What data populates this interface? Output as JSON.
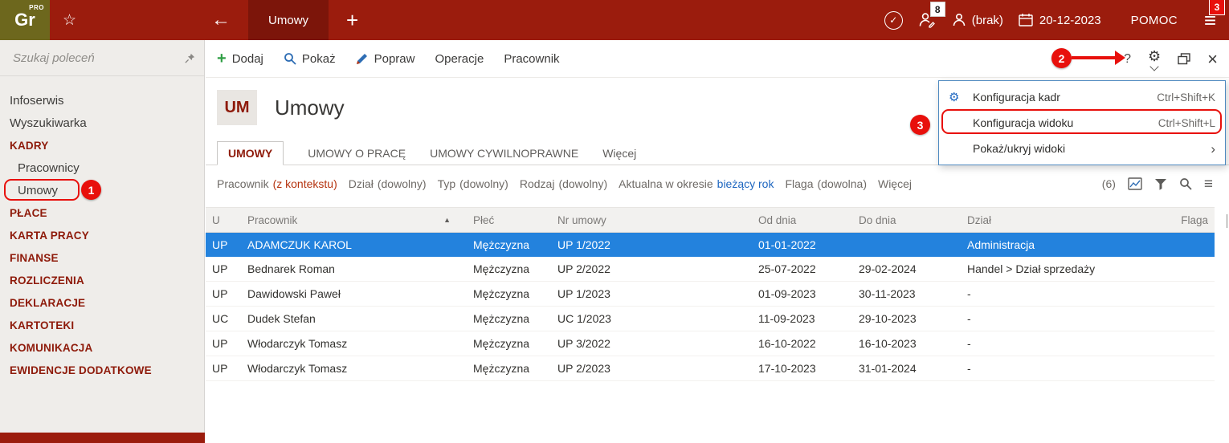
{
  "colors": {
    "brand_red": "#9b1c0d",
    "logo_olive": "#6d671d",
    "annotation_red": "#e8100c",
    "selection_blue": "#2382dd",
    "sidebar_header_red": "#8e1a0a",
    "filter_value_red": "#b5330f",
    "filter_value_blue": "#1f67c0"
  },
  "topbar": {
    "logo_text": "Gr",
    "logo_sup": "PRO",
    "active_tab": "Umowy",
    "sessions_badge": "8",
    "user_label": "(brak)",
    "date": "20-12-2023",
    "help_label": "POMOC",
    "menu_badge": "3"
  },
  "sidebar": {
    "search_placeholder": "Szukaj poleceń",
    "items": [
      {
        "label": "Infoserwis"
      },
      {
        "label": "Wyszukiwarka"
      },
      {
        "label": "KADRY"
      },
      {
        "label": "Pracownicy"
      },
      {
        "label": "Umowy"
      },
      {
        "label": "PŁACE"
      },
      {
        "label": "KARTA PRACY"
      },
      {
        "label": "FINANSE"
      },
      {
        "label": "ROZLICZENIA"
      },
      {
        "label": "DEKLARACJE"
      },
      {
        "label": "KARTOTEKI"
      },
      {
        "label": "KOMUNIKACJA"
      },
      {
        "label": "EWIDENCJE DODATKOWE"
      }
    ]
  },
  "toolbar": {
    "add_label": "Dodaj",
    "show_label": "Pokaż",
    "edit_label": "Popraw",
    "operations_label": "Operacje",
    "employee_label": "Pracownik"
  },
  "context_menu": {
    "items": [
      {
        "label": "Konfiguracja kadr",
        "shortcut": "Ctrl+Shift+K"
      },
      {
        "label": "Konfiguracja widoku",
        "shortcut": "Ctrl+Shift+L"
      },
      {
        "label": "Pokaż/ukryj widoki"
      }
    ]
  },
  "page": {
    "module_badge": "UM",
    "title": "Umowy",
    "tabs": [
      {
        "label": "UMOWY"
      },
      {
        "label": "UMOWY O PRACĘ"
      },
      {
        "label": "UMOWY CYWILNOPRAWNE"
      },
      {
        "label": "Więcej"
      }
    ],
    "filters": [
      {
        "label": "Pracownik",
        "value": "(z kontekstu)"
      },
      {
        "label": "Dział",
        "value": "(dowolny)"
      },
      {
        "label": "Typ",
        "value": "(dowolny)"
      },
      {
        "label": "Rodzaj",
        "value": "(dowolny)"
      },
      {
        "label": "Aktualna w okresie",
        "value": "bieżący rok"
      },
      {
        "label": "Flaga",
        "value": "(dowolna)"
      },
      {
        "label": "Więcej",
        "value": ""
      }
    ],
    "record_count": "(6)"
  },
  "table": {
    "columns": [
      "U",
      "Pracownik",
      "Płeć",
      "Nr umowy",
      "Od dnia",
      "Do dnia",
      "Dział",
      "Flaga"
    ],
    "rows": [
      {
        "u": "UP",
        "pracownik": "ADAMCZUK KAROL",
        "plec": "Mężczyzna",
        "nr_umowy": "UP 1/2022",
        "od_dnia": "01-01-2022",
        "do_dnia": "",
        "dzial": "Administracja",
        "flaga": ""
      },
      {
        "u": "UP",
        "pracownik": "Bednarek Roman",
        "plec": "Mężczyzna",
        "nr_umowy": "UP 2/2022",
        "od_dnia": "25-07-2022",
        "do_dnia": "29-02-2024",
        "dzial": "Handel > Dział sprzedaży",
        "flaga": ""
      },
      {
        "u": "UP",
        "pracownik": "Dawidowski Paweł",
        "plec": "Mężczyzna",
        "nr_umowy": "UP 1/2023",
        "od_dnia": "01-09-2023",
        "do_dnia": "30-11-2023",
        "dzial": "-",
        "flaga": ""
      },
      {
        "u": "UC",
        "pracownik": "Dudek Stefan",
        "plec": "Mężczyzna",
        "nr_umowy": "UC 1/2023",
        "od_dnia": "11-09-2023",
        "do_dnia": "29-10-2023",
        "dzial": "-",
        "flaga": ""
      },
      {
        "u": "UP",
        "pracownik": "Włodarczyk Tomasz",
        "plec": "Mężczyzna",
        "nr_umowy": "UP 3/2022",
        "od_dnia": "16-10-2022",
        "do_dnia": "16-10-2023",
        "dzial": "-",
        "flaga": ""
      },
      {
        "u": "UP",
        "pracownik": "Włodarczyk Tomasz",
        "plec": "Mężczyzna",
        "nr_umowy": "UP 2/2023",
        "od_dnia": "17-10-2023",
        "do_dnia": "31-01-2024",
        "dzial": "-",
        "flaga": ""
      }
    ]
  },
  "annotations": {
    "step1": "1",
    "step2": "2",
    "step3": "3"
  }
}
